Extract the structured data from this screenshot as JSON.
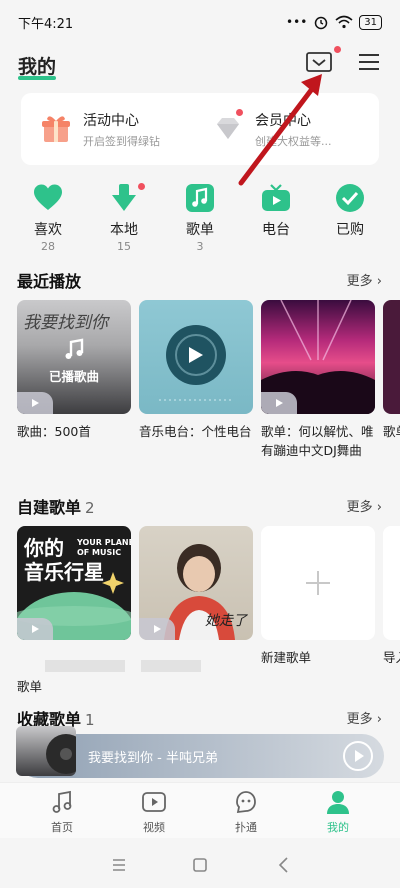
{
  "status_bar": {
    "time": "下午4:21",
    "signal_text": "•••",
    "battery": "31"
  },
  "header": {
    "title": "我的"
  },
  "promo": [
    {
      "title": "活动中心",
      "subtitle": "开启签到得绿钻"
    },
    {
      "title": "会员中心",
      "subtitle": "创建大权益等..."
    }
  ],
  "quick": [
    {
      "label": "喜欢",
      "count": "28",
      "icon": "heart-icon"
    },
    {
      "label": "本地",
      "count": "15",
      "icon": "download-icon"
    },
    {
      "label": "歌单",
      "count": "3",
      "icon": "music-note-icon"
    },
    {
      "label": "电台",
      "count": "",
      "icon": "tv-icon"
    },
    {
      "label": "已购",
      "count": "",
      "icon": "check-icon"
    }
  ],
  "recent": {
    "title": "最近播放",
    "more": "更多 ›",
    "cards": [
      {
        "overlay": "已播歌曲",
        "cover_text": "我要找到你",
        "label": "歌曲：500首"
      },
      {
        "label": "音乐电台：个性电台"
      },
      {
        "label": "歌单：何以解忧、唯有蹦迪中文DJ舞曲"
      },
      {
        "label": "歌单"
      }
    ]
  },
  "created": {
    "title": "自建歌单",
    "count": "2",
    "more": "更多 ›",
    "cards": [
      {
        "cover_big": "你的\n音乐行星",
        "cover_small": "YOUR PLANET\nOF MUSIC",
        "label": "歌单"
      },
      {
        "cover_text": "她走了",
        "label": ""
      },
      {
        "label": "新建歌单"
      },
      {
        "label": "导入"
      }
    ]
  },
  "favorites": {
    "title": "收藏歌单",
    "count": "1",
    "more": "更多 ›"
  },
  "player": {
    "title": "我要找到你 - 半吨兄弟"
  },
  "tabs": [
    {
      "label": "首页",
      "icon": "music-note-icon"
    },
    {
      "label": "视频",
      "icon": "video-play-icon"
    },
    {
      "label": "扑通",
      "icon": "bubble-icon"
    },
    {
      "label": "我的",
      "icon": "person-icon"
    }
  ],
  "colors": {
    "accent": "#2ec28b",
    "badge": "#f0505e",
    "annotation": "#c0161d"
  }
}
